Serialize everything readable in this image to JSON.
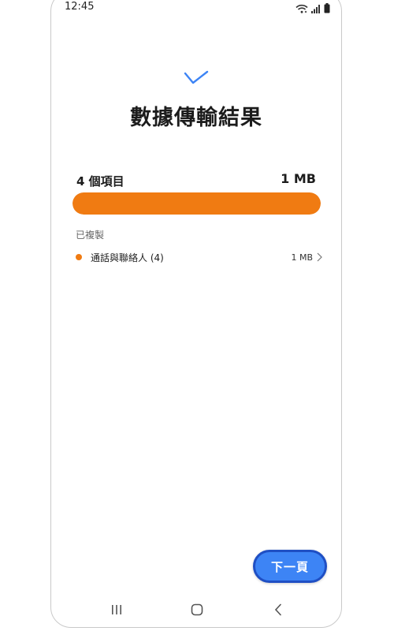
{
  "status_bar": {
    "time": "12:45",
    "icons": [
      "wifi-icon",
      "signal-icon",
      "battery-icon"
    ]
  },
  "header": {
    "check_icon": "checkmark-icon",
    "title": "數據傳輸結果"
  },
  "summary": {
    "item_count": "4 個項目",
    "total_size": "1 MB",
    "progress_percent": 100
  },
  "section": {
    "label": "已複製"
  },
  "items": [
    {
      "label": "通話與聯絡人 (4)",
      "size": "1 MB"
    }
  ],
  "actions": {
    "next_label": "下一頁"
  },
  "nav": {
    "icons": [
      "recent-apps-icon",
      "home-icon",
      "back-icon"
    ]
  },
  "colors": {
    "accent_orange": "#f07b12",
    "primary_blue": "#3d84f5",
    "check_blue": "#3d84f5"
  }
}
